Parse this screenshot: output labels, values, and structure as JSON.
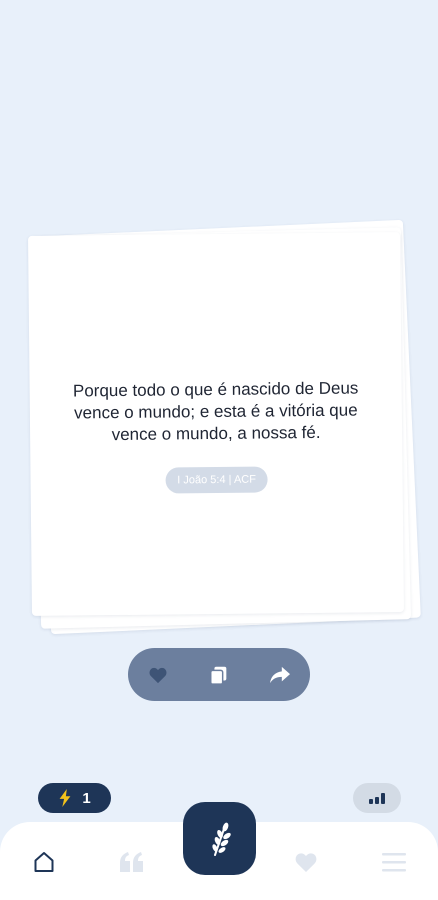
{
  "card": {
    "verse": "Porque todo o que é nascido de Deus vence o mundo; e esta é a vitória que vence o mundo, a nossa fé.",
    "reference": "I João 5:4 | ACF"
  },
  "actions": {
    "like_icon": "heart-icon",
    "copy_icon": "copy-icon",
    "share_icon": "share-icon"
  },
  "streak": {
    "icon": "lightning-icon",
    "count": "1"
  },
  "level": {
    "icon": "signal-bars-icon"
  },
  "nav": {
    "items": [
      "home-icon",
      "quote-icon",
      "wheat-icon",
      "heart-icon",
      "menu-icon"
    ],
    "active": "home-icon"
  },
  "colors": {
    "background": "#e8f0fa",
    "navy": "#1e3557",
    "slate": "#6c7f9e",
    "badge": "#d3dbe7"
  }
}
